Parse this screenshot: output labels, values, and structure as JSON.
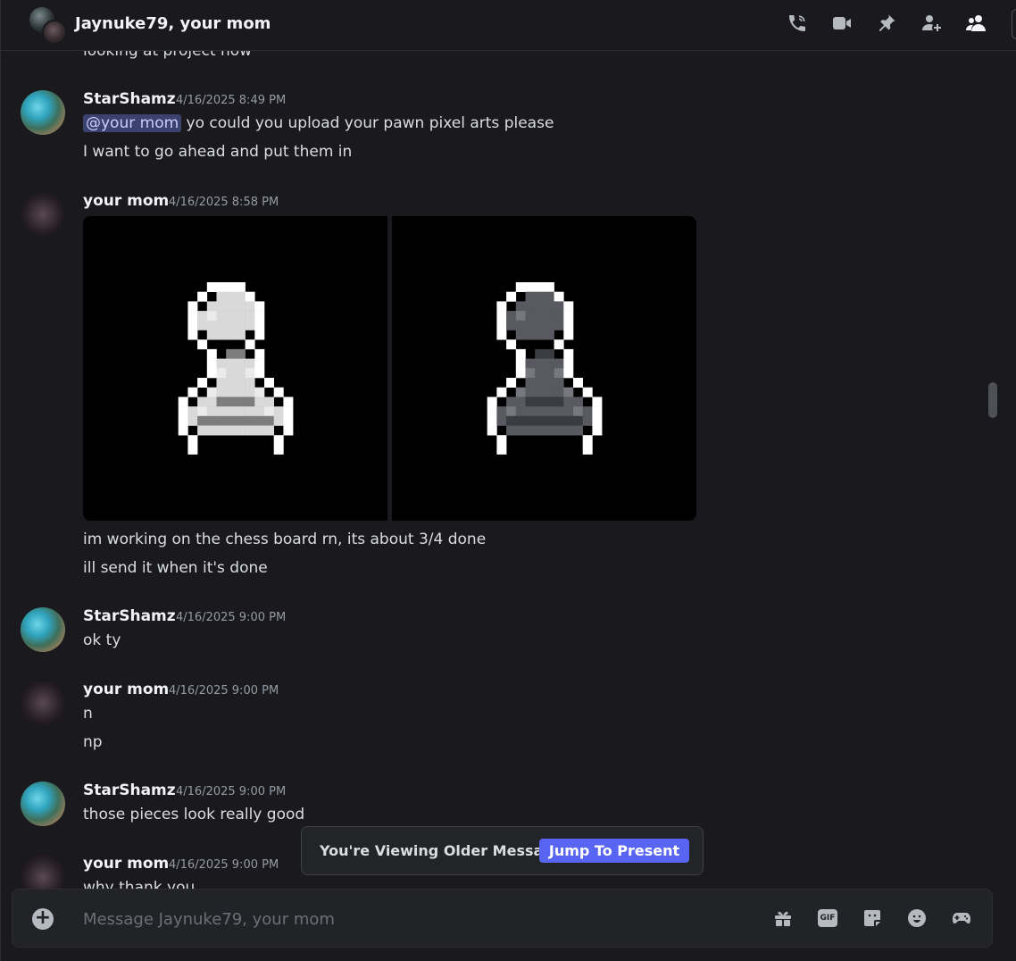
{
  "header": {
    "title": "Jaynuke79, your mom",
    "icons": [
      "voice-call-icon",
      "video-call-icon",
      "pinned-messages-icon",
      "add-friends-to-dm-icon",
      "members-list-icon"
    ]
  },
  "messages": {
    "cut_top_text": "looking at project now",
    "m1": {
      "author": "StarShamz",
      "time": "4/16/2025 8:49 PM",
      "mention": "@your mom",
      "line1_rest": " yo could you upload your pawn pixel arts please",
      "line2": "I want to go ahead and put them in"
    },
    "m2": {
      "author": "your mom",
      "time": "4/16/2025 8:58 PM",
      "attachments": [
        "white-pawn-pixel-art",
        "black-pawn-pixel-art"
      ],
      "line1": "im working on the chess board rn, its about 3/4 done",
      "line2": "ill send it when it's done"
    },
    "m3": {
      "author": "StarShamz",
      "time": "4/16/2025 9:00 PM",
      "line1": "ok ty"
    },
    "m4": {
      "author": "your mom",
      "time": "4/16/2025 9:00 PM",
      "line1": "n",
      "line2": "np"
    },
    "m5": {
      "author": "StarShamz",
      "time": "4/16/2025 9:00 PM",
      "line1": "those pieces look really good"
    },
    "m6": {
      "author": "your mom",
      "time": "4/16/2025 9:00 PM",
      "line1": "why thank you"
    }
  },
  "older_bar": {
    "text": "You're Viewing Older Messages",
    "button": "Jump To Present"
  },
  "composer": {
    "placeholder": "Message Jaynuke79, your mom",
    "gif_label": "GIF",
    "icons": [
      "gift-icon",
      "gif-icon",
      "sticker-icon",
      "emoji-icon",
      "activities-icon"
    ]
  },
  "colors": {
    "background": "#1a1a1e",
    "accent": "#5865f2",
    "mention_bg": "#3c4270"
  }
}
